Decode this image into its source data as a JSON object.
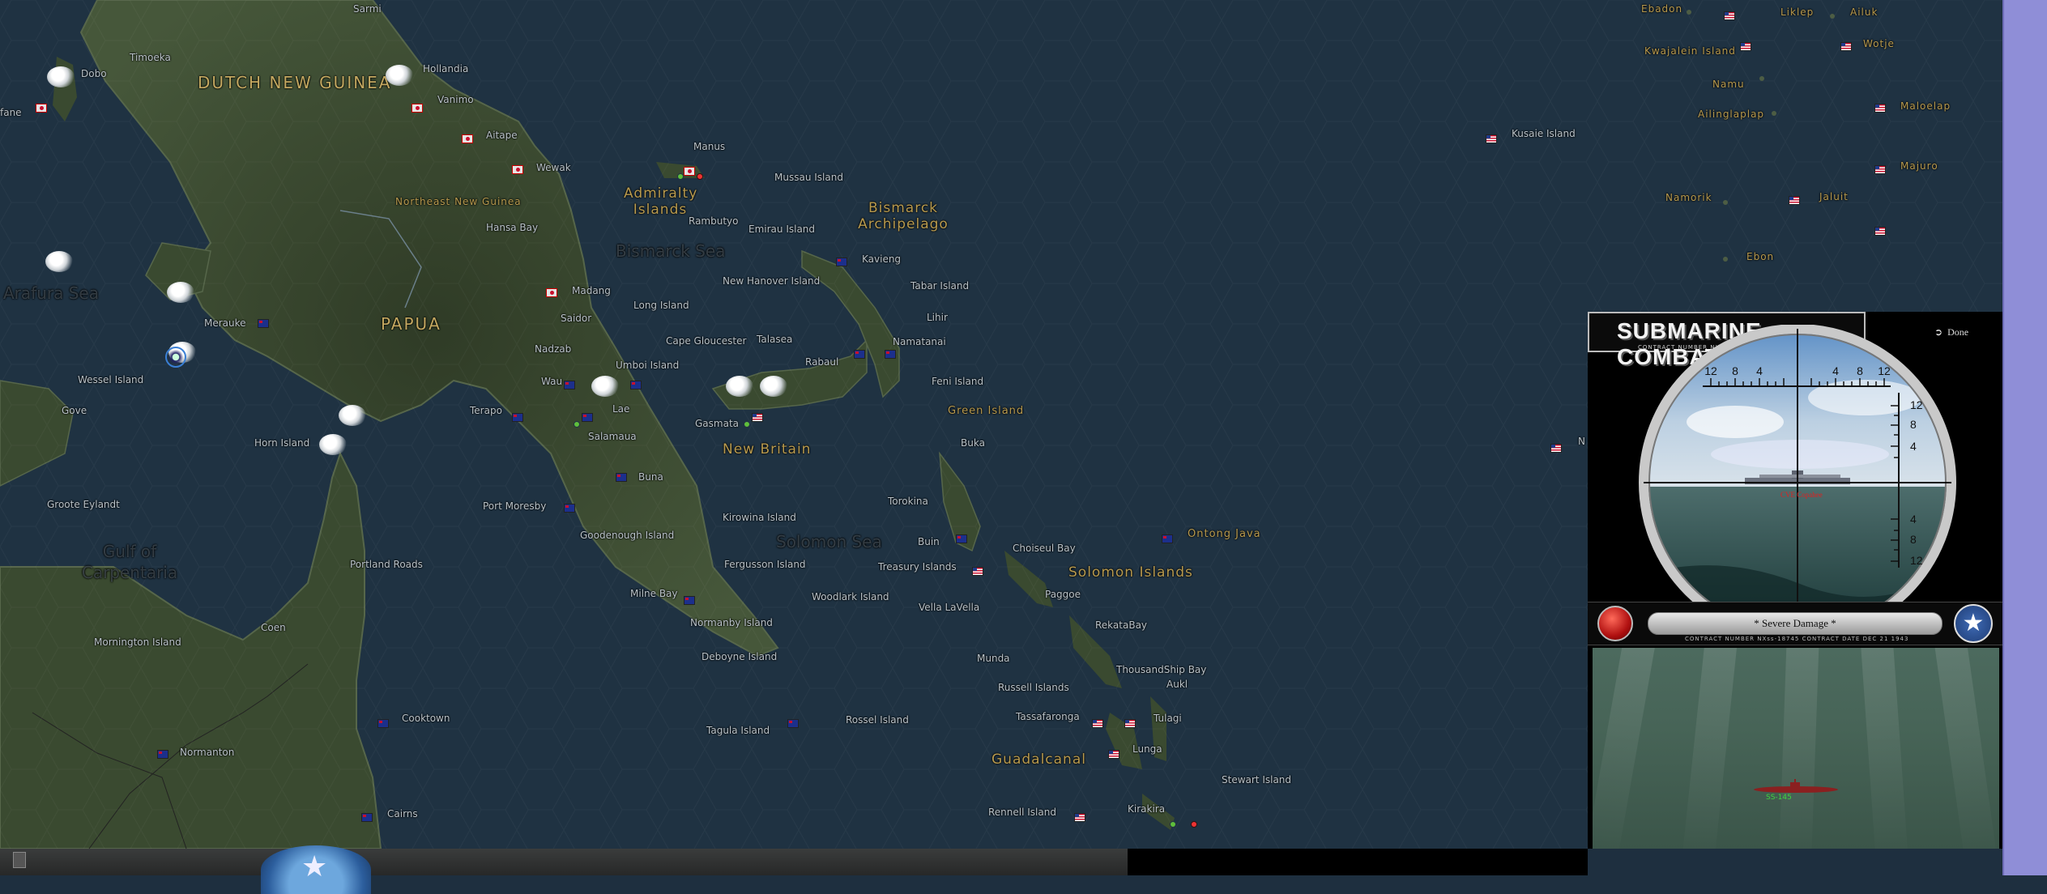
{
  "map": {
    "regions": [
      {
        "id": "dutch-new-guinea",
        "text": "DUTCH NEW GUINEA"
      },
      {
        "id": "papua",
        "text": "PAPUA"
      },
      {
        "id": "new-britain",
        "text": "New Britain"
      },
      {
        "id": "solomon-islands",
        "text": "Solomon Islands"
      },
      {
        "id": "guadalcanal",
        "text": "Guadalcanal"
      },
      {
        "id": "bismarck-archipelago",
        "text": "Bismarck Archipelago"
      },
      {
        "id": "admiralty-islands",
        "text": "Admiralty Islands"
      },
      {
        "id": "northeast-new-guinea",
        "text": "Northeast New Guinea"
      },
      {
        "id": "green-island",
        "text": "Green Island"
      },
      {
        "id": "ontong-java",
        "text": "Ontong Java"
      }
    ],
    "seas": [
      {
        "id": "arafura-sea",
        "text": "Arafura Sea"
      },
      {
        "id": "gulf-of-carpentaria",
        "text": "Gulf of Carpentaria"
      },
      {
        "id": "bismarck-sea",
        "text": "Bismarck Sea"
      },
      {
        "id": "solomon-sea",
        "text": "Solomon Sea"
      }
    ],
    "places": [
      "Sarmi",
      "Timoeka",
      "Dobo",
      "fane",
      "Hollandia",
      "Vanimo",
      "Aitape",
      "Wewak",
      "Hansa Bay",
      "Madang",
      "Saidor",
      "Nadzab",
      "Wau",
      "Lae",
      "Salamaua",
      "Terapo",
      "Buna",
      "Port Moresby",
      "Goodenough Island",
      "Milne Bay",
      "Merauke",
      "Wessel Island",
      "Gove",
      "Horn Island",
      "Groote Eylandt",
      "Portland Roads",
      "Coen",
      "Mornington Island",
      "Cooktown",
      "Normanton",
      "Cairns",
      "Manus",
      "Mussau Island",
      "Rambutyo",
      "Emirau Island",
      "Kavieng",
      "New Hanover Island",
      "Tabar Island",
      "Long Island",
      "Lihir",
      "Cape Gloucester",
      "Talasea",
      "Namatanai",
      "Rabaul",
      "Umboi Island",
      "Feni Island",
      "Gasmata",
      "Buka",
      "Kirowina Island",
      "Torokina",
      "Fergusson Island",
      "Treasury Islands",
      "Buin",
      "Choiseul Bay",
      "Woodlark Island",
      "Vella LaVella",
      "Paggoe",
      "Normanby Island",
      "RekataBay",
      "Munda",
      "ThousandShip Bay",
      "Deboyne Island",
      "Aukl",
      "Russell Islands",
      "Tagula Island",
      "Rossel Island",
      "Tassafaronga",
      "Tulagi",
      "Lunga",
      "Stewart Island",
      "Rennell Island",
      "Kirakira",
      "Kusaie Island",
      "Ebadon",
      "Liklep",
      "Ailuk",
      "Kwajalein Island",
      "Wotje",
      "Namu",
      "Ailinglaplap",
      "Maloelap",
      "Majuro",
      "Namorik",
      "Jaluit",
      "Ebon",
      "N"
    ]
  },
  "panel": {
    "title": "SUBMARINE COMBAT",
    "subtitle": "CONTRACT NUMBER  NXss-18745        CONTRACT DATE  DEC  21  1943",
    "done_label": "Done",
    "scope": {
      "top_scale": [
        "12",
        "8",
        "4",
        "4",
        "8",
        "12"
      ],
      "right_scale": [
        "12",
        "8",
        "4",
        "4",
        "8",
        "12"
      ],
      "target_label": "CVE Copahee"
    },
    "status": "* Severe Damage *",
    "sub_label": "SS-145"
  },
  "colors": {
    "ocean": "#1e2f3f",
    "land": "#3b4b30",
    "right_bar": "#8f8ed7",
    "region_text": "#b89a4e"
  }
}
